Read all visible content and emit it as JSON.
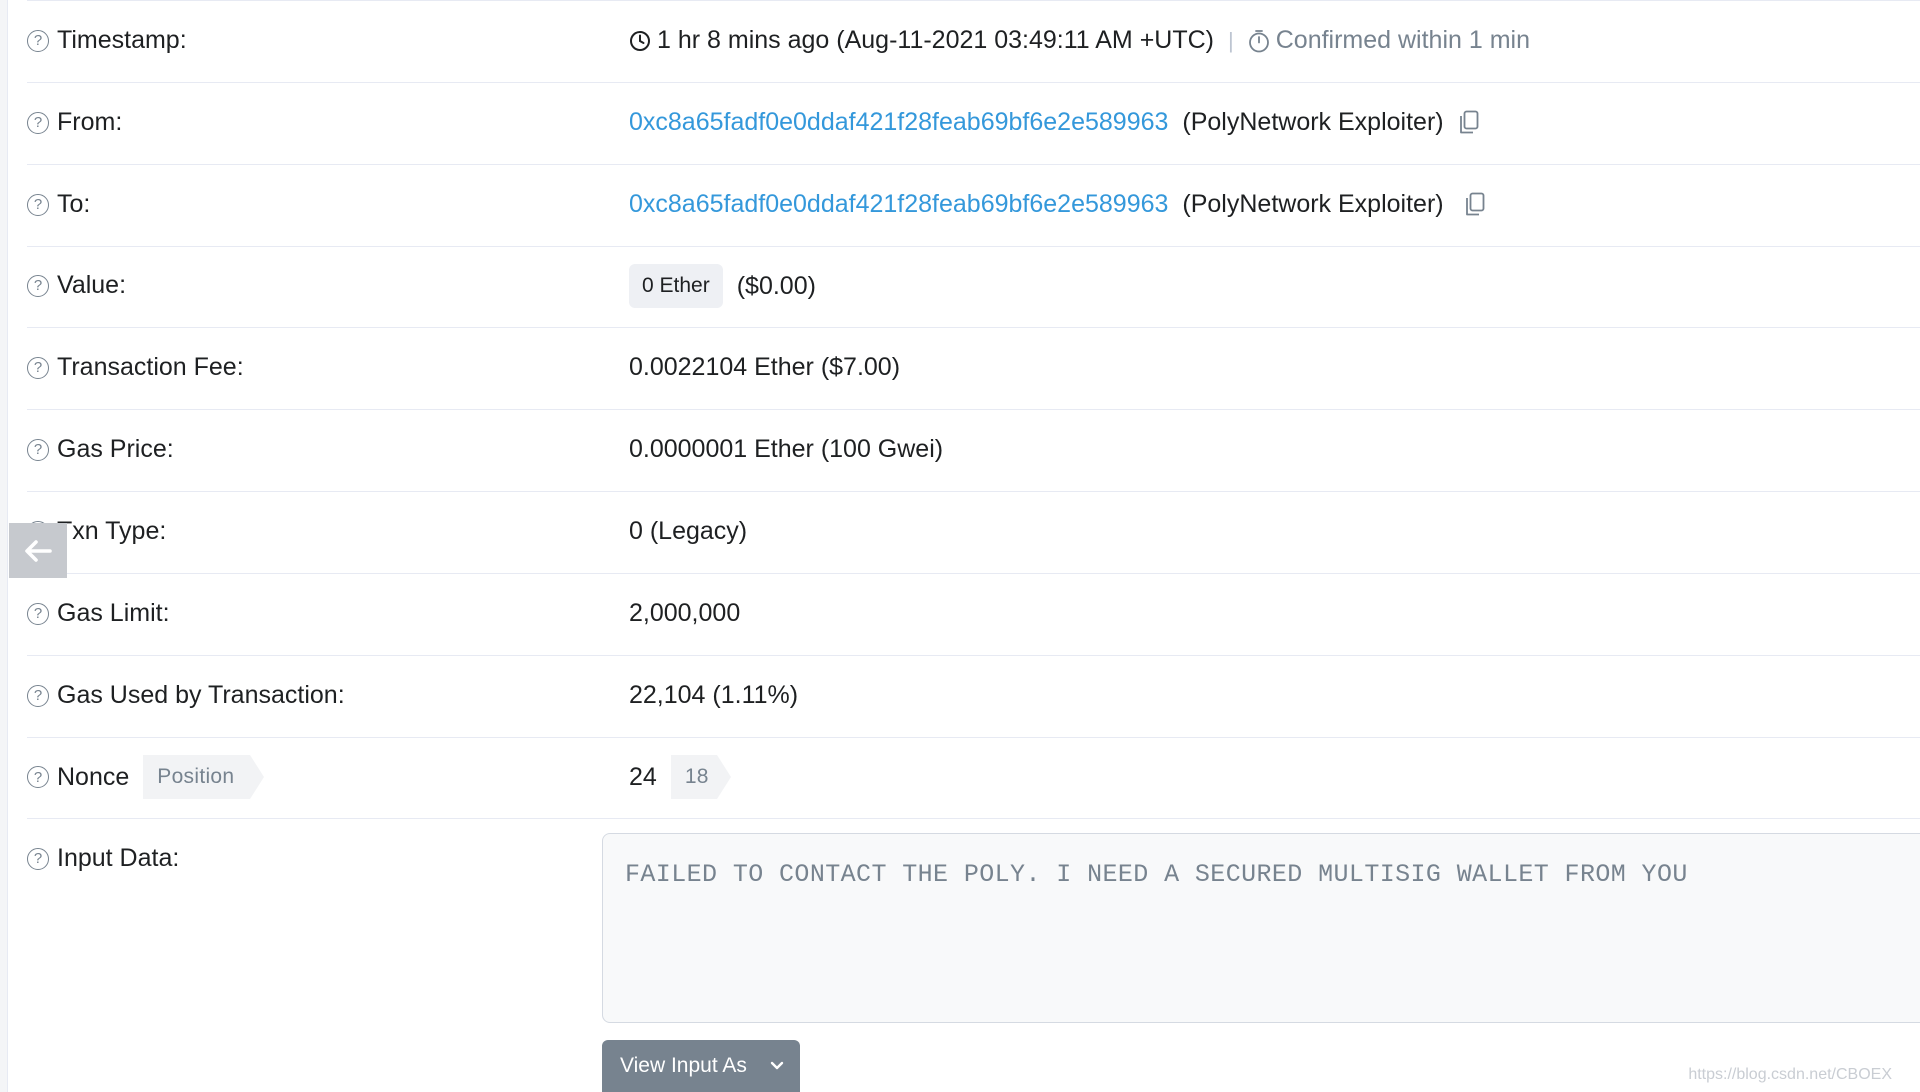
{
  "rows": {
    "timestamp": {
      "label": "Timestamp:",
      "age": "1 hr 8 mins ago (Aug-11-2021 03:49:11 AM +UTC)",
      "separator": "|",
      "confirmed": "Confirmed within 1 min"
    },
    "from": {
      "label": "From:",
      "address": "0xc8a65fadf0e0ddaf421f28feab69bf6e2e589963",
      "name": "(PolyNetwork Exploiter)"
    },
    "to": {
      "label": "To:",
      "address": "0xc8a65fadf0e0ddaf421f28feab69bf6e2e589963",
      "name": "(PolyNetwork Exploiter)"
    },
    "value": {
      "label": "Value:",
      "badge": "0 Ether",
      "usd": "($0.00)"
    },
    "fee": {
      "label": "Transaction Fee:",
      "text": "0.0022104 Ether ($7.00)"
    },
    "gas_price": {
      "label": "Gas Price:",
      "text": "0.0000001 Ether (100 Gwei)"
    },
    "txn_type": {
      "label": "Txn Type:",
      "text": "0 (Legacy)"
    },
    "gas_limit": {
      "label": "Gas Limit:",
      "text": "2,000,000"
    },
    "gas_used": {
      "label": "Gas Used by Transaction:",
      "text": "22,104 (1.11%)"
    },
    "nonce": {
      "label": "Nonce",
      "position_tag": "Position",
      "nonce_value": "24",
      "position_value": "18"
    },
    "input_data": {
      "label": "Input Data:",
      "text": "FAILED TO CONTACT THE POLY. I NEED A SECURED MULTISIG WALLET FROM YOU",
      "button": "View Input As"
    }
  },
  "help_glyph": "?",
  "icons": {
    "clock": "clock-icon",
    "stopwatch": "stopwatch-icon",
    "copy": "copy-icon",
    "back": "arrow-left-icon",
    "chevron": "chevron-down-icon"
  },
  "watermark": "https://blog.csdn.net/CBOEX",
  "colors": {
    "link": "#3498db",
    "muted": "#77838f",
    "border": "#e7eaf3",
    "button": "#77838f"
  }
}
